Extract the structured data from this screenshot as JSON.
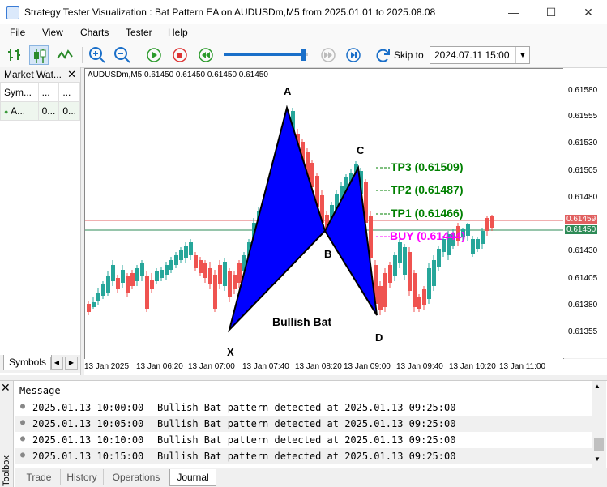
{
  "window": {
    "title": "Strategy Tester Visualization : Bat Pattern EA on AUDUSDm,M5 from 2025.01.01 to 2025.08.08"
  },
  "menu": [
    "File",
    "View",
    "Charts",
    "Tester",
    "Help"
  ],
  "toolbar": {
    "skip_label": "Skip to",
    "skip_date": "2024.07.11 15:00",
    "speed_percent": 95
  },
  "market_watch": {
    "title": "Market Wat...",
    "headers": [
      "Sym...",
      "...",
      "..."
    ],
    "row": [
      "A...",
      "0...",
      "0..."
    ],
    "tab": "Symbols"
  },
  "chart": {
    "info": "AUDUSDm,M5  0.61450 0.61450 0.61450 0.61450",
    "price_ticks": [
      "0.61580",
      "0.61555",
      "0.61530",
      "0.61505",
      "0.61480",
      "0.61430",
      "0.61405",
      "0.61380",
      "0.61355"
    ],
    "bid_price": "0.61450",
    "ask_price": "0.61459",
    "time_ticks": [
      "13 Jan 2025",
      "13 Jan 06:20",
      "13 Jan 07:00",
      "13 Jan 07:40",
      "13 Jan 08:20",
      "13 Jan 09:00",
      "13 Jan 09:40",
      "13 Jan 10:20",
      "13 Jan 11:00"
    ],
    "points": {
      "X": "X",
      "A": "A",
      "B": "B",
      "C": "C",
      "D": "D"
    },
    "pattern_label": "Bullish Bat",
    "tp3": "TP3 (0.61509)",
    "tp2": "TP2 (0.61487)",
    "tp1": "TP1 (0.61466)",
    "buy": "BUY (0.61444)",
    "colors": {
      "bull": "#26a69a",
      "bear": "#ef5350",
      "pattern": "#0000ff",
      "tp": "#008000",
      "buy": "#ff00ff",
      "bid_line": "#2e8b57",
      "ask_line": "#e06060"
    }
  },
  "toolbox": {
    "side_label": "Toolbox",
    "header": "Message",
    "rows": [
      {
        "time": "2025.01.13 10:00:00",
        "text": "Bullish Bat pattern detected at 2025.01.13 09:25:00"
      },
      {
        "time": "2025.01.13 10:05:00",
        "text": "Bullish Bat pattern detected at 2025.01.13 09:25:00"
      },
      {
        "time": "2025.01.13 10:10:00",
        "text": "Bullish Bat pattern detected at 2025.01.13 09:25:00"
      },
      {
        "time": "2025.01.13 10:15:00",
        "text": "Bullish Bat pattern detected at 2025.01.13 09:25:00"
      }
    ],
    "tabs": [
      "Trade",
      "History",
      "Operations",
      "Journal"
    ]
  }
}
